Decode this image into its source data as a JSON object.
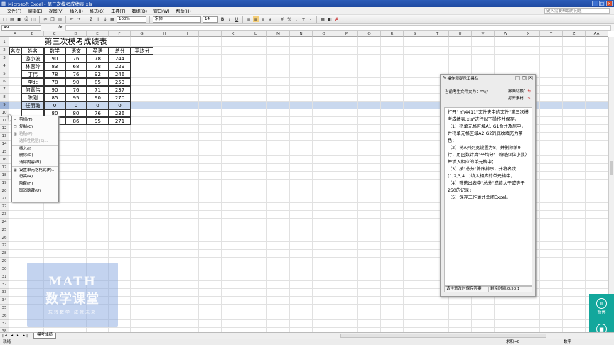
{
  "window": {
    "title": "Microsoft Excel - 第三次模考成绩表.xls"
  },
  "menu": [
    "文件(F)",
    "编辑(E)",
    "视图(V)",
    "插入(I)",
    "格式(O)",
    "工具(T)",
    "数据(D)",
    "窗口(W)",
    "帮助(H)"
  ],
  "help_placeholder": "键入需要帮助的问题",
  "toolbar": {
    "zoom": "100%",
    "font": "宋体",
    "size": "14"
  },
  "name_box": "A9",
  "columns": [
    "A",
    "B",
    "C",
    "D",
    "E",
    "F",
    "G",
    "H",
    "I",
    "J",
    "K",
    "L",
    "M",
    "N",
    "O",
    "P",
    "Q",
    "R",
    "S",
    "T",
    "U",
    "V",
    "W",
    "X",
    "Y",
    "Z",
    "AA"
  ],
  "sheet": {
    "title": "第三次模考成绩表",
    "headers": [
      "名次",
      "姓名",
      "数学",
      "语文",
      "英语",
      "总分",
      "平均分"
    ],
    "rows": [
      [
        "",
        "游小波",
        "90",
        "76",
        "78",
        "244"
      ],
      [
        "",
        "林惠玲",
        "83",
        "68",
        "78",
        "229"
      ],
      [
        "",
        "丁伟",
        "78",
        "76",
        "92",
        "246"
      ],
      [
        "",
        "李菲",
        "78",
        "90",
        "85",
        "253"
      ],
      [
        "",
        "何嘉伟",
        "90",
        "76",
        "71",
        "237"
      ],
      [
        "",
        "陈刚",
        "85",
        "95",
        "90",
        "270"
      ],
      [
        "",
        "任丽璐",
        "0",
        "0",
        "0",
        "0"
      ],
      [
        "",
        "",
        "80",
        "80",
        "76",
        "236"
      ],
      [
        "",
        "",
        "90",
        "86",
        "95",
        "271"
      ]
    ]
  },
  "context_menu": [
    {
      "label": "剪切(T)",
      "icon": "scissors-icon",
      "disabled": false
    },
    {
      "label": "复制(C)",
      "icon": "copy-icon",
      "disabled": false
    },
    {
      "label": "粘贴(P)",
      "icon": "paste-icon",
      "disabled": true
    },
    {
      "label": "选择性粘贴(S)...",
      "icon": "",
      "disabled": true
    },
    {
      "label": "插入(I)",
      "icon": "",
      "disabled": false,
      "sep": true
    },
    {
      "label": "删除(D)",
      "icon": "",
      "disabled": false
    },
    {
      "label": "清除内容(N)",
      "icon": "",
      "disabled": false
    },
    {
      "label": "设置单元格格式(F)...",
      "icon": "format-cells-icon",
      "disabled": false,
      "sep": true
    },
    {
      "label": "行高(R)...",
      "icon": "",
      "disabled": false
    },
    {
      "label": "隐藏(H)",
      "icon": "",
      "disabled": false
    },
    {
      "label": "取消隐藏(U)",
      "icon": "",
      "disabled": false
    }
  ],
  "tip_panel": {
    "title": "操作题提示工具栏",
    "folder_label": "当前考生文件夹为：\"Y:\\\"",
    "btn_switch": "界面切换：",
    "btn_open": "打开素材：",
    "body": [
      "打开\" Y:\\4411\"文件夹中的文件\"第三次模考成绩表.xls\"进行以下操作并保存。",
      "（1）将单元格区域A1:G1合并及居中，并将单元格区域A2:G2的底纹填充为茶色；",
      "（2）将A列列宽设置为8，并删除第9行，用函数计算\"平均分\"（保留2位小数）并填入相应的单元格中；",
      "（3）按\"总分\"降序排序，并将名次(1,2,3,4…)填入相应的单元格中；",
      "（4）筛选出表中\"总分\"成绩大于或等于250的记录；",
      "（5）保存工作薄并关闭Excel。"
    ],
    "footer_left": "请注意及时保存答案",
    "footer_right": "剩余时间:0:53:1"
  },
  "watermark": {
    "line1": "MATH",
    "line2": "数学课堂",
    "line3": "玩转数学 成就未来"
  },
  "recorder": {
    "pause": "暂停",
    "stop": "停止"
  },
  "sheet_tab": "模考成绩",
  "status": {
    "left": "就绪",
    "sum": "求和=0",
    "mode": "数字"
  }
}
